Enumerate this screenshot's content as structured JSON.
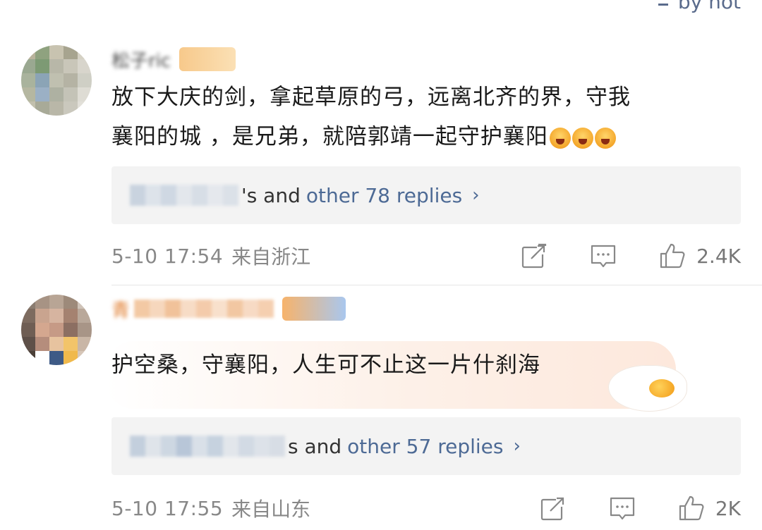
{
  "header": {
    "sort_label": "by hot"
  },
  "comments": [
    {
      "username": "松子ric",
      "text_line1": "放下大庆的剑，拿起草原的弓，远离北齐的界，守我",
      "text_line2": "襄阳的城 ，是兄弟，就陪郭靖一起守护襄阳",
      "replies_user": "y···ni121",
      "replies_suffix": "'s and",
      "replies_link": "other 78 replies",
      "time": "5-10 17:54",
      "location": "来自浙江",
      "likes": "2.4K"
    },
    {
      "username": "青",
      "text_line1": "护空桑，守襄阳，人生可不止这一片什刹海",
      "replies_user": "cat···第",
      "replies_suffix": "s and",
      "replies_link": "other 57 replies",
      "time": "5-10 17:55",
      "location": "来自山东",
      "likes": "2K"
    }
  ],
  "colors": {
    "link": "#4d6a95",
    "meta": "#888888",
    "reply_bg": "#f3f3f3"
  }
}
